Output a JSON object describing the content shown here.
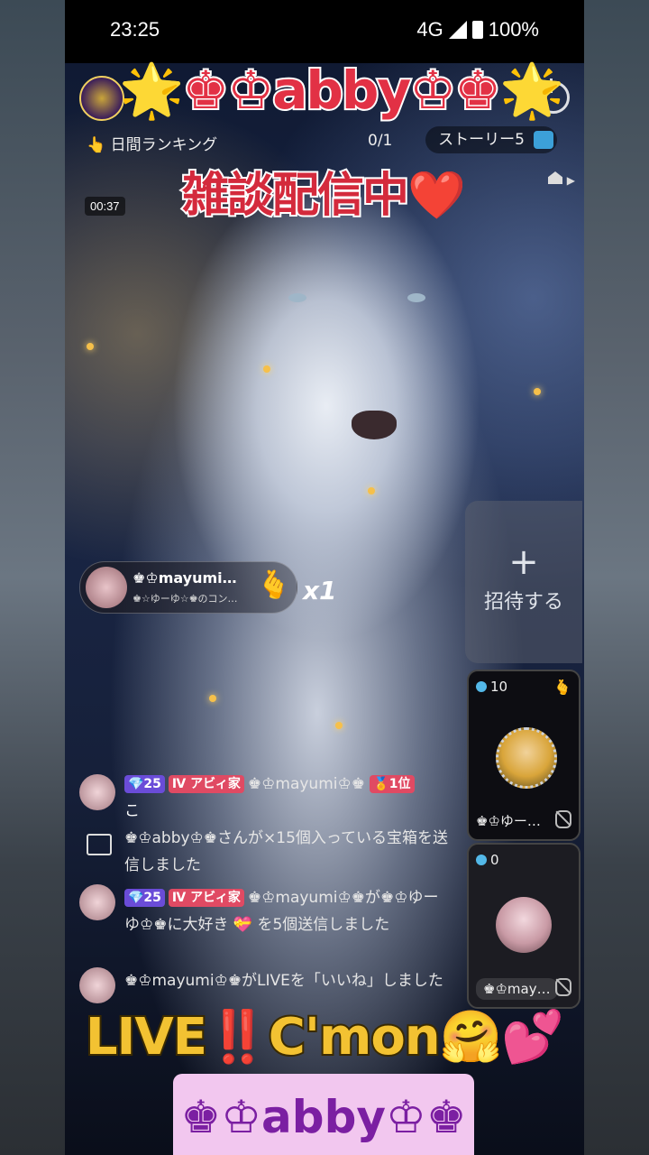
{
  "status_bar": {
    "time": "23:25",
    "network": "4G",
    "battery": "100%"
  },
  "stream": {
    "title_overlay": "🌟♚♔abby♔♚🌟",
    "ranking_label": "日間ランキング",
    "viewer_count": "0/1",
    "story_label": "ストーリー5",
    "subtitle_overlay": "雑談配信中❤️",
    "elapsed_time": "00:37"
  },
  "invite": {
    "plus": "+",
    "label": "招待する"
  },
  "guests": [
    {
      "count": "10",
      "name": "♚♔ゆー…",
      "heart": "🫰"
    },
    {
      "count": "0",
      "name": "♚♔may…"
    }
  ],
  "gift_banner": {
    "sender": "♚♔mayumi…",
    "subtext": "♚☆ゆーゆ☆♚のコン…",
    "gift_icon": "🫰",
    "multiplier": "x1"
  },
  "chat": {
    "messages": [
      {
        "level": "💎25",
        "family": "Ⅳ アビィ家",
        "user": "♚♔mayumi♔♚",
        "rank": "🏅1位",
        "text": "こ"
      },
      {
        "text": "♚♔abby♔♚さんが×15個入っている宝箱を送信しました"
      },
      {
        "level": "💎25",
        "family": "Ⅳ アビィ家",
        "text": "♚♔mayumi♔♚が♚♔ゆーゆ♔♚に大好き 💝 を5個送信しました"
      },
      {
        "text": "♚♔mayumi♔♚がLIVEを「いいね」しました"
      }
    ]
  },
  "bottom_overlay": {
    "line1_a": "LIVE",
    "line1_b": "‼️",
    "line1_c": "C'mon🤗💕"
  },
  "name_banner": "♚♔abby♔♚"
}
